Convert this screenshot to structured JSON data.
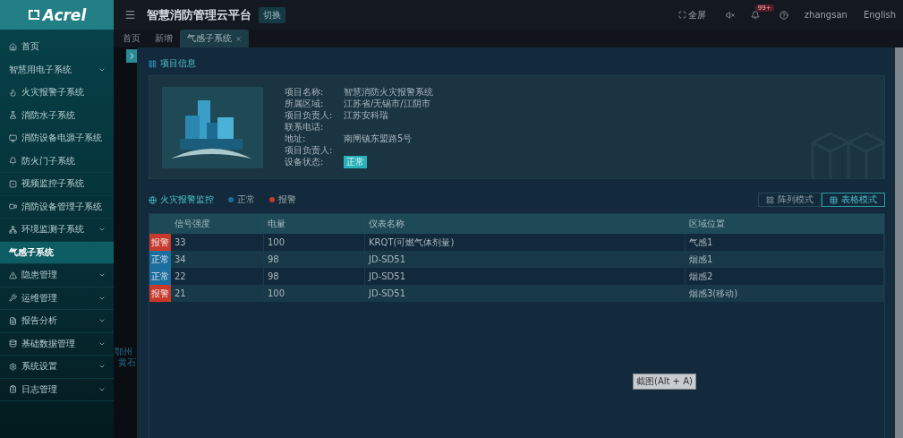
{
  "logo": {
    "text": "Acrel"
  },
  "sidebar": {
    "items": [
      {
        "label": "首页",
        "expandable": false,
        "selected": false
      },
      {
        "label": "智慧用电子系统",
        "expandable": true,
        "selected": false
      },
      {
        "label": "火灾报警子系统",
        "expandable": false,
        "selected": false
      },
      {
        "label": "消防水子系统",
        "expandable": false,
        "selected": false
      },
      {
        "label": "消防设备电源子系统",
        "expandable": false,
        "selected": false
      },
      {
        "label": "防火门子系统",
        "expandable": false,
        "selected": false
      },
      {
        "label": "视频监控子系统",
        "expandable": false,
        "selected": false
      },
      {
        "label": "消防设备管理子系统",
        "expandable": false,
        "selected": false
      },
      {
        "label": "环境监测子系统",
        "expandable": true,
        "selected": false
      },
      {
        "label": "气感子系统",
        "expandable": false,
        "selected": true
      },
      {
        "label": "隐患管理",
        "expandable": true,
        "selected": false
      },
      {
        "label": "运维管理",
        "expandable": true,
        "selected": false
      },
      {
        "label": "报告分析",
        "expandable": true,
        "selected": false
      },
      {
        "label": "基础数据管理",
        "expandable": true,
        "selected": false
      },
      {
        "label": "系统设置",
        "expandable": true,
        "selected": false
      },
      {
        "label": "日志管理",
        "expandable": true,
        "selected": false
      }
    ]
  },
  "header": {
    "title": "智慧消防管理云平台",
    "switch_button": "切换",
    "fullscreen": "全屏",
    "notification_badge": "99+",
    "user": "zhangsan",
    "language": "English"
  },
  "tabs": [
    {
      "label": "首页",
      "selected": false,
      "closable": false
    },
    {
      "label": "新增",
      "selected": false,
      "closable": false
    },
    {
      "label": "气感子系统",
      "selected": true,
      "closable": true
    }
  ],
  "map_labels": [
    "鄂州",
    "黄石"
  ],
  "project_info": {
    "title": "项目信息",
    "fields": [
      {
        "label": "项目名称:",
        "value": "智慧消防火灾报警系统"
      },
      {
        "label": "所属区域:",
        "value": "江苏省/无锡市/江阴市"
      },
      {
        "label": "项目负责人:",
        "value": "江苏安科瑞"
      },
      {
        "label": "联系电话:"
      },
      {
        "label": "地址:",
        "value": "南闸镇东盟路5号"
      },
      {
        "label": "项目负责人:"
      },
      {
        "label": "设备状态:",
        "status": "正常"
      }
    ]
  },
  "monitor": {
    "title": "火灾报警监控",
    "legend": [
      {
        "label": "正常",
        "color": "#1a6fa0"
      },
      {
        "label": "报警",
        "color": "#c8392b"
      }
    ],
    "view_modes": [
      {
        "label": "阵列模式",
        "selected": false
      },
      {
        "label": "表格模式",
        "selected": true
      }
    ]
  },
  "table": {
    "columns": [
      "信号强度",
      "电量",
      "仪表名称",
      "区域位置"
    ],
    "rows": [
      {
        "status": "报警",
        "kind": "alarm",
        "cells": [
          "33",
          "100",
          "KRQT(可燃气体剂量)",
          "气感1"
        ]
      },
      {
        "status": "正常",
        "kind": "normal",
        "cells": [
          "34",
          "98",
          "JD-SD51",
          "烟感1"
        ]
      },
      {
        "status": "正常",
        "kind": "normal",
        "cells": [
          "22",
          "98",
          "JD-SD51",
          "烟感2"
        ]
      },
      {
        "status": "报警",
        "kind": "alarm",
        "cells": [
          "21",
          "100",
          "JD-SD51",
          "烟感3(移动)"
        ]
      }
    ]
  },
  "tooltip": "截图(Alt + A)"
}
